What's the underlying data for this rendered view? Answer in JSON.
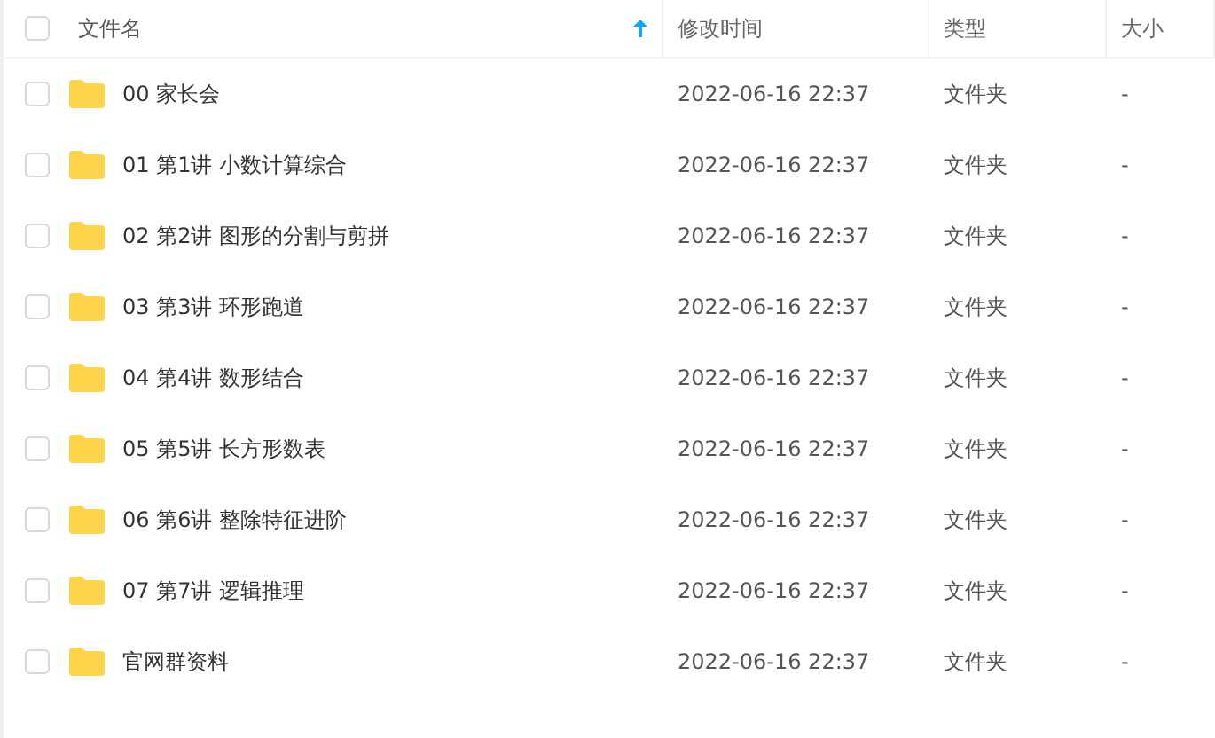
{
  "header": {
    "checked": false,
    "columns": [
      {
        "label": "文件名",
        "sorted": true
      },
      {
        "label": "修改时间",
        "sorted": false
      },
      {
        "label": "类型",
        "sorted": false
      },
      {
        "label": "大小",
        "sorted": false
      }
    ]
  },
  "rows": [
    {
      "name": "00 家长会",
      "modified": "2022-06-16 22:37",
      "type": "文件夹",
      "size": "-",
      "checked": false
    },
    {
      "name": "01 第1讲 小数计算综合",
      "modified": "2022-06-16 22:37",
      "type": "文件夹",
      "size": "-",
      "checked": false
    },
    {
      "name": "02 第2讲 图形的分割与剪拼",
      "modified": "2022-06-16 22:37",
      "type": "文件夹",
      "size": "-",
      "checked": false
    },
    {
      "name": "03 第3讲 环形跑道",
      "modified": "2022-06-16 22:37",
      "type": "文件夹",
      "size": "-",
      "checked": false
    },
    {
      "name": "04 第4讲 数形结合",
      "modified": "2022-06-16 22:37",
      "type": "文件夹",
      "size": "-",
      "checked": false
    },
    {
      "name": "05 第5讲 长方形数表",
      "modified": "2022-06-16 22:37",
      "type": "文件夹",
      "size": "-",
      "checked": false
    },
    {
      "name": "06 第6讲 整除特征进阶",
      "modified": "2022-06-16 22:37",
      "type": "文件夹",
      "size": "-",
      "checked": false
    },
    {
      "name": "07 第7讲 逻辑推理",
      "modified": "2022-06-16 22:37",
      "type": "文件夹",
      "size": "-",
      "checked": false
    },
    {
      "name": "官网群资料",
      "modified": "2022-06-16 22:37",
      "type": "文件夹",
      "size": "-",
      "checked": false
    }
  ]
}
